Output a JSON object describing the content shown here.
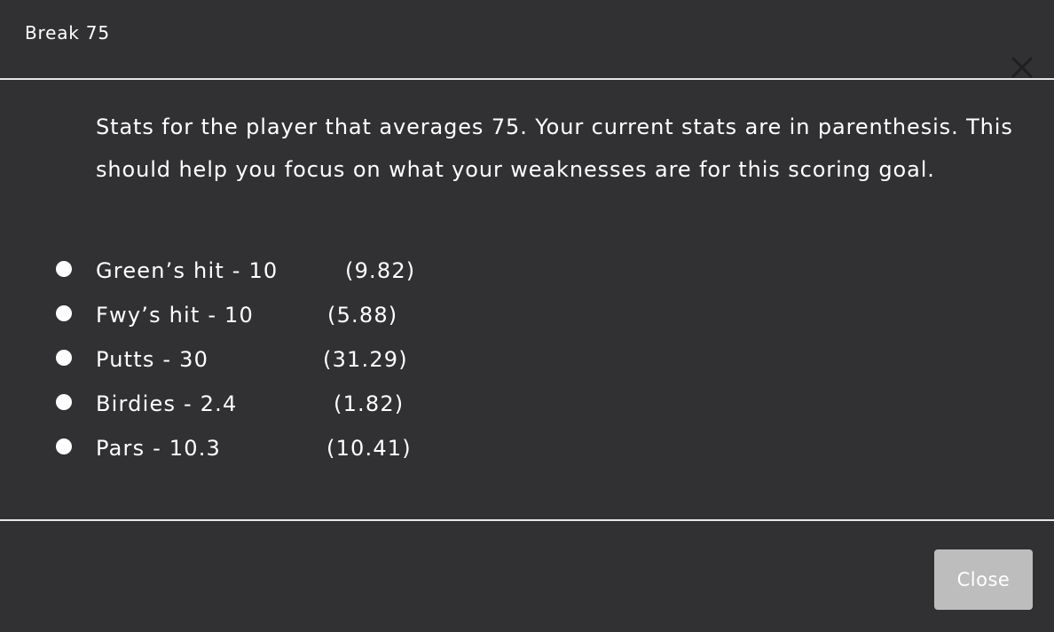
{
  "modal": {
    "title": "Break 75",
    "close_icon": "close-x-icon",
    "intro": "Stats for the player that averages 75. Your current stats are in parenthesis. This should help you focus on what your weaknesses are for this scoring goal.",
    "stats": [
      {
        "label": "Green’s hit - 10",
        "current": "(9.82)"
      },
      {
        "label": "Fwy’s hit - 10",
        "current": "(5.88)"
      },
      {
        "label": "Putts - 30",
        "current": "(31.29)"
      },
      {
        "label": "Birdies - 2.4",
        "current": "(1.82)"
      },
      {
        "label": "Pars - 10.3",
        "current": "(10.41)"
      }
    ],
    "close_button_label": "Close"
  },
  "colors": {
    "background": "#313033",
    "text": "#ffffff",
    "divider": "#e6e6e6",
    "button": "#bdbdbd",
    "close_icon": "#1f1f21"
  }
}
